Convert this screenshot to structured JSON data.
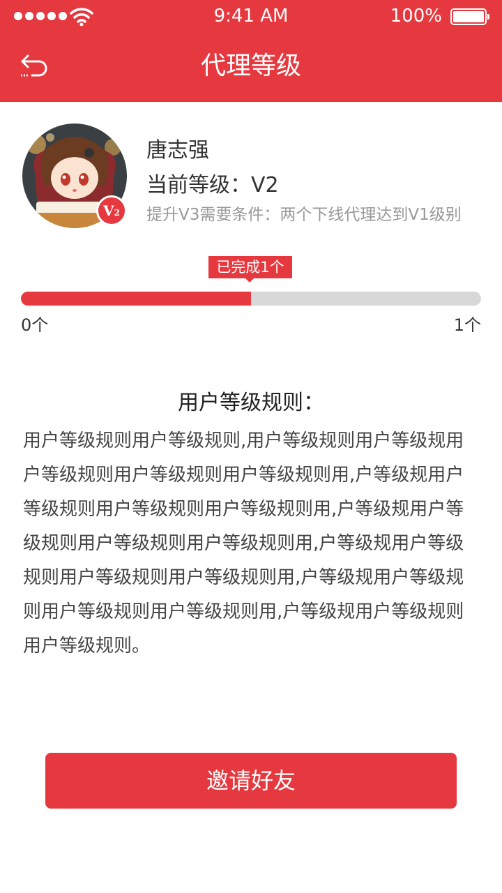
{
  "status_bar": {
    "time": "9:41 AM",
    "battery": "100%"
  },
  "nav": {
    "title": "代理等级"
  },
  "profile": {
    "name": "唐志强",
    "level": "当前等级：V2",
    "badge": "V",
    "badge_sub": "2",
    "condition": "提升V3需要条件：两个下线代理达到V1级别"
  },
  "progress": {
    "tip": "已完成1个",
    "min_label": "0个",
    "max_label": "1个",
    "fraction": 0.5
  },
  "rules": {
    "title": "用户等级规则：",
    "body": "用户等级规则用户等级规则,用户等级规则用户等级规用户等级规则用户等级规则用户等级规则用,户等级规用户等级规则用户等级规则用户等级规则用,户等级规用户等级规则用户等级规则用户等级规则用,户等级规用户等级规则用户等级规则用户等级规则用,户等级规用户等级规则用户等级规则用户等级规则用,户等级规用户等级规则用户等级规则。"
  },
  "actions": {
    "invite_label": "邀请好友"
  },
  "colors": {
    "accent": "#e5383f",
    "track": "#d8d8d8"
  }
}
